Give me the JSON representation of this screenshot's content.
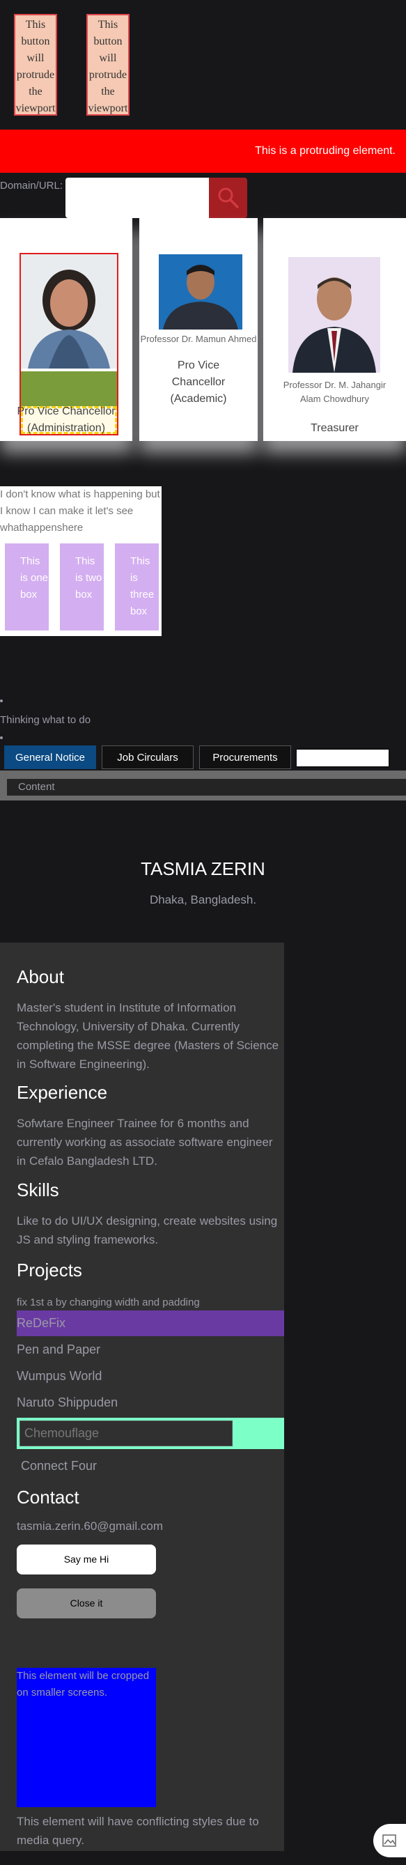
{
  "protrude_buttons": [
    {
      "label": "This button will protrude the viewport"
    },
    {
      "label": "This button will protrude the viewport"
    }
  ],
  "red_bar": {
    "text": "This is a protruding element."
  },
  "domain": {
    "label": "Domain/URL:",
    "value": "",
    "placeholder": ""
  },
  "cards": [
    {
      "role": "Pro Vice Chancellor (Administration)"
    },
    {
      "name": "Professor Dr. Mamun Ahmed",
      "role": "Pro Vice Chancellor (Academic)"
    },
    {
      "name": "Professor Dr. M. Jahangir Alam Chowdhury",
      "role": "Treasurer"
    }
  ],
  "box_section": {
    "text": "I don't know what is happening but I know I can make it let's see whathappenshere",
    "boxes": [
      "This is one box",
      "This is two box",
      "This is three box"
    ]
  },
  "bullets": {
    "text": "Thinking what to do"
  },
  "tabs": [
    {
      "label": "General Notice",
      "active": true
    },
    {
      "label": "Job Circulars",
      "active": false
    },
    {
      "label": "Procurements",
      "active": false
    },
    {
      "label": "",
      "active": false
    }
  ],
  "content_bar": {
    "label": "Content"
  },
  "profile": {
    "name": "TASMIA ZERIN",
    "location": "Dhaka, Bangladesh."
  },
  "about": {
    "heading": "About",
    "text": "Master's student in Institute of Information Technology, University of Dhaka. Currently completing the MSSE degree (Masters of Science in Software Engineering)."
  },
  "experience": {
    "heading": "Experience",
    "text": "Sofwtare Engineer Trainee for 6 months and currently working as associate software engineer in Cefalo Bangladesh LTD."
  },
  "skills": {
    "heading": "Skills",
    "text": "Like to do UI/UX designing, create websites using JS and styling frameworks."
  },
  "projects": {
    "heading": "Projects",
    "note": "fix 1st a by changing width and padding",
    "items": [
      "ReDeFix",
      "Pen and Paper",
      "Wumpus World",
      "Naruto Shippuden",
      "Chemouflage",
      "Connect Four"
    ]
  },
  "contact": {
    "heading": "Contact",
    "email": "tasmia.zerin.60@gmail.com",
    "say_hi": "Say me Hi",
    "close": "Close it"
  },
  "blue_box": {
    "text": "This element will be cropped on smaller screens."
  },
  "conflict": {
    "text": "This element will have conflicting styles due to media query."
  },
  "colors": {
    "accent_red": "#ff0000",
    "blue_box": "#0000ff",
    "purple": "#6a3aa3",
    "mint": "#7dffc8",
    "tab_active": "#0b4a82"
  }
}
